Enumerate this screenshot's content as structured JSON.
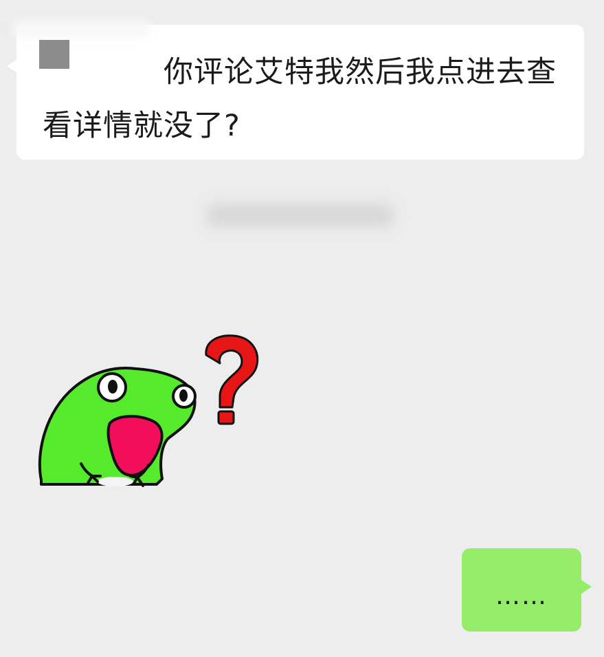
{
  "conversation": {
    "incoming": {
      "text": "你评论艾特我然后我点进去查看详情就没了?"
    },
    "timestamp": "",
    "sticker": {
      "name": "frog-question-sticker",
      "mark": "?"
    },
    "outgoing": {
      "text": "……"
    }
  },
  "colors": {
    "background": "#ededed",
    "incoming_bubble": "#ffffff",
    "outgoing_bubble": "#95ec69",
    "frog": "#55ea2c",
    "mouth": "#f30e5c",
    "question_mark": "#e61616"
  }
}
